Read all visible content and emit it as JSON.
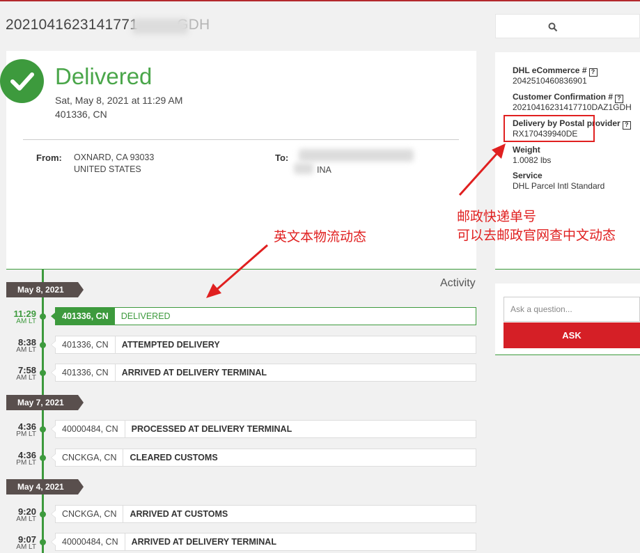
{
  "header": {
    "tracking_number_partial": "2021041623141771",
    "tracking_number_end": "GDH"
  },
  "search": {
    "icon": "search-icon"
  },
  "status": {
    "title": "Delivered",
    "date": "Sat, May 8, 2021 at 11:29 AM",
    "location": "401336, CN",
    "color": "#4aa64a"
  },
  "shipment": {
    "from_label": "From:",
    "from_line1": "OXNARD, CA 93033",
    "from_line2": "UNITED STATES",
    "to_label": "To:",
    "to_line2": "INA"
  },
  "info": {
    "ecommerce_label": "DHL eCommerce #",
    "ecommerce_value": "2042510460836901",
    "confirmation_label": "Customer Confirmation #",
    "confirmation_value": "20210416231417710DAZ1GDH",
    "postal_label": "Delivery by Postal provider",
    "postal_value": "RX170439940DE",
    "weight_label": "Weight",
    "weight_value": "1.0082 lbs",
    "service_label": "Service",
    "service_value": "DHL Parcel Intl Standard",
    "help_glyph": "?"
  },
  "ask": {
    "placeholder": "Ask a question...",
    "button_label": "ASK",
    "button_color": "#d51f26"
  },
  "activity": {
    "label": "Activity",
    "dates": [
      "May 8, 2021",
      "May 7, 2021",
      "May 4, 2021"
    ],
    "events": [
      {
        "time": "11:29",
        "ampm": "AM LT",
        "location": "401336, CN",
        "description": "DELIVERED"
      },
      {
        "time": "8:38",
        "ampm": "AM LT",
        "location": "401336, CN",
        "description": "ATTEMPTED DELIVERY"
      },
      {
        "time": "7:58",
        "ampm": "AM LT",
        "location": "401336, CN",
        "description": "ARRIVED AT DELIVERY TERMINAL"
      },
      {
        "time": "4:36",
        "ampm": "PM LT",
        "location": "40000484, CN",
        "description": "PROCESSED AT DELIVERY TERMINAL"
      },
      {
        "time": "4:36",
        "ampm": "PM LT",
        "location": "CNCKGA, CN",
        "description": "CLEARED CUSTOMS"
      },
      {
        "time": "9:20",
        "ampm": "AM LT",
        "location": "CNCKGA, CN",
        "description": "ARRIVED AT CUSTOMS"
      },
      {
        "time": "9:07",
        "ampm": "AM LT",
        "location": "40000484, CN",
        "description": "ARRIVED AT DELIVERY TERMINAL"
      }
    ]
  },
  "annotations": {
    "english_tracking": "英文本物流动态",
    "postal_number_line1": "邮政快递单号",
    "postal_number_line2": "可以去邮政官网查中文动态",
    "color": "#e02020"
  }
}
